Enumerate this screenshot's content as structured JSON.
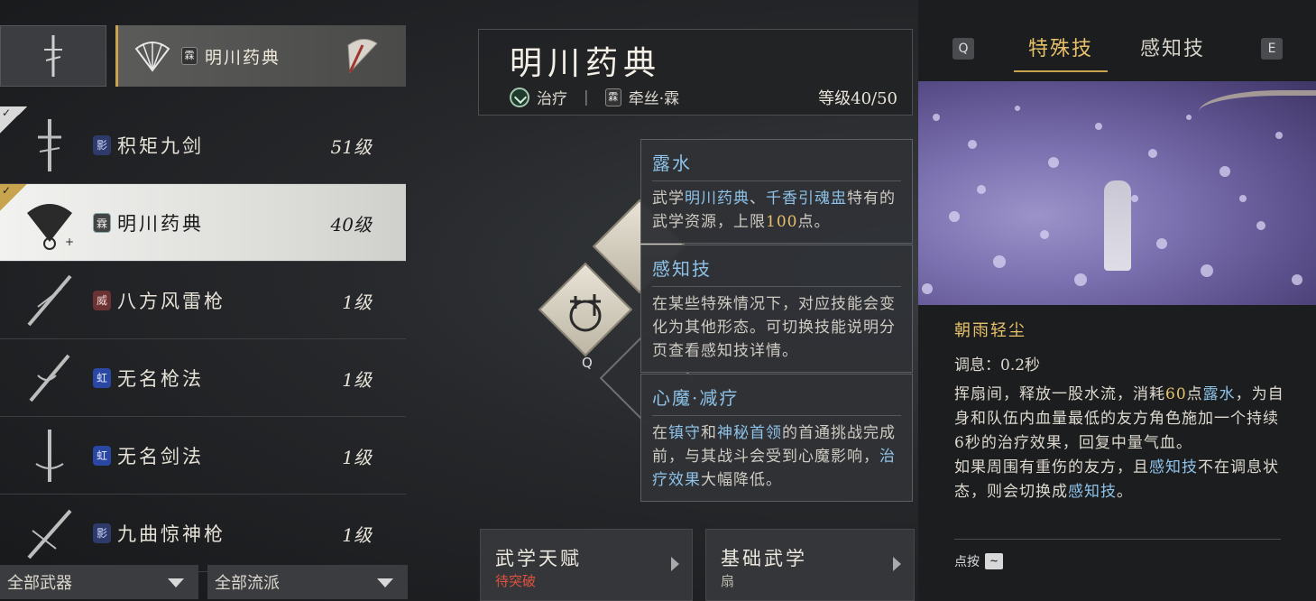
{
  "left": {
    "category_tab": {
      "label": "明川药典",
      "badge": "霖"
    },
    "weapons": [
      {
        "badge": "影",
        "name": "积矩九剑",
        "level": "51级",
        "checked": true
      },
      {
        "badge": "霖",
        "name": "明川药典",
        "level": "40级",
        "checked": true,
        "selected": true
      },
      {
        "badge": "威",
        "name": "八方风雷枪",
        "level": "1级"
      },
      {
        "badge": "虹",
        "name": "无名枪法",
        "level": "1级"
      },
      {
        "badge": "虹",
        "name": "无名剑法",
        "level": "1级"
      },
      {
        "badge": "影",
        "name": "九曲惊神枪",
        "level": "1级"
      }
    ],
    "filters": {
      "weapons": "全部武器",
      "schools": "全部流派"
    }
  },
  "center": {
    "title": "明川药典",
    "role": "治疗",
    "badge": "霖",
    "path": "牵丝·霖",
    "level": "等级40/50",
    "q_label": "Q",
    "tooltips": [
      {
        "title": "露水",
        "p1": "武学",
        "h1": "明川药典",
        "p2": "、",
        "h2": "千香引魂盅",
        "p3": "特有的武学资源，上限",
        "h3": "100",
        "p4": "点。"
      },
      {
        "title": "感知技",
        "text": "在某些特殊情况下，对应技能会变化为其他形态。可切换技能说明分页查看感知技详情。"
      },
      {
        "title": "心魔·减疗",
        "p1": "在",
        "h1": "镇守",
        "p2": "和",
        "h2": "神秘首领",
        "p3": "的首通挑战完成前，与其战斗会受到心魔影响，",
        "h3": "治疗效果",
        "p4": "大幅降低。"
      }
    ],
    "cards": [
      {
        "title": "武学天赋",
        "sub": "待突破"
      },
      {
        "title": "基础武学",
        "sub": "扇"
      }
    ]
  },
  "right": {
    "key_left": "Q",
    "key_right": "E",
    "tab_special": "特殊技",
    "tab_perception": "感知技",
    "skill_name": "朝雨轻尘",
    "cooldown": "调息：0.2秒",
    "desc": {
      "a": "挥扇间，释放一股水流，消耗",
      "b": "60",
      "c": "点",
      "d": "露水",
      "e": "，为自身和队伍内血量最低的友方角色施加一个持续6秒的治疗效果，回复中量气血。",
      "f": "如果周围有重伤的友方，且",
      "g": "感知技",
      "h": "不在调息状态，则会切换成",
      "i": "感知技",
      "j": "。"
    },
    "press_hint": "点按",
    "press_key": "~"
  }
}
